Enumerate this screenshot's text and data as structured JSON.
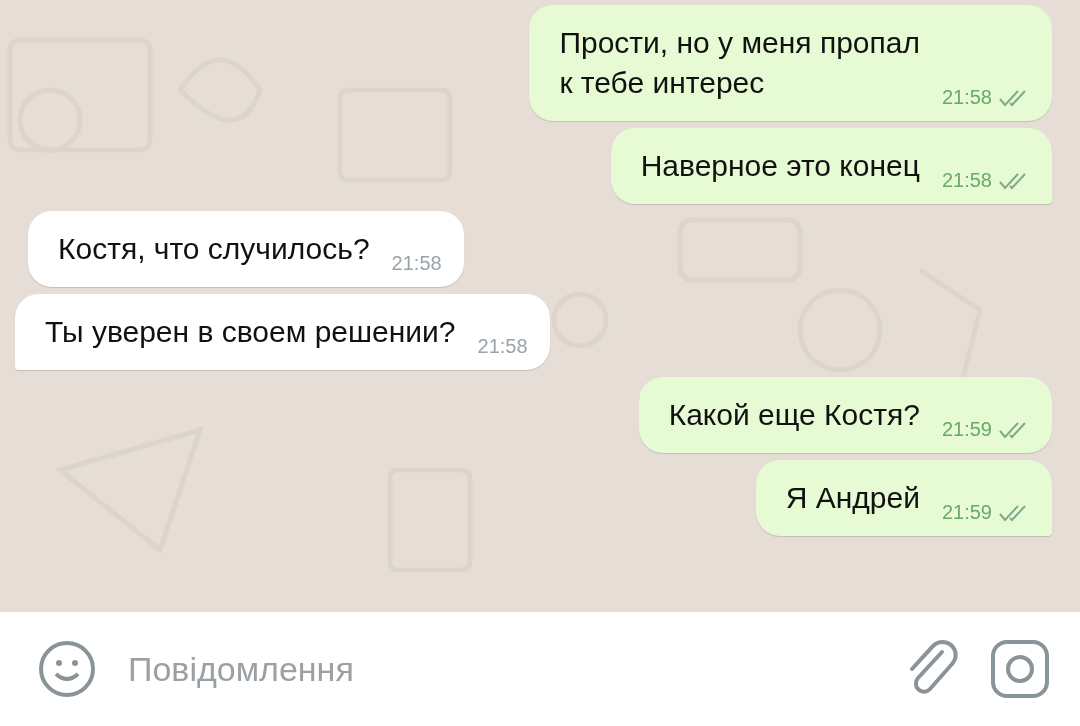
{
  "messages": [
    {
      "kind": "outgoing",
      "text": "Прости, но у меня пропал\nк тебе интерес",
      "time": "21:58",
      "read": true,
      "tail": false
    },
    {
      "kind": "outgoing",
      "text": "Наверное это конец",
      "time": "21:58",
      "read": true,
      "tail": true
    },
    {
      "kind": "incoming",
      "text": "Костя, что случилось?",
      "time": "21:58",
      "tail": false
    },
    {
      "kind": "incoming",
      "text": "Ты уверен в своем решении?",
      "time": "21:58",
      "tail": true
    },
    {
      "kind": "outgoing",
      "text": "Какой еще Костя?",
      "time": "21:59",
      "read": true,
      "tail": false
    },
    {
      "kind": "outgoing",
      "text": "Я Андрей",
      "time": "21:59",
      "read": true,
      "tail": true
    }
  ],
  "composer": {
    "placeholder": "Повідомлення"
  }
}
